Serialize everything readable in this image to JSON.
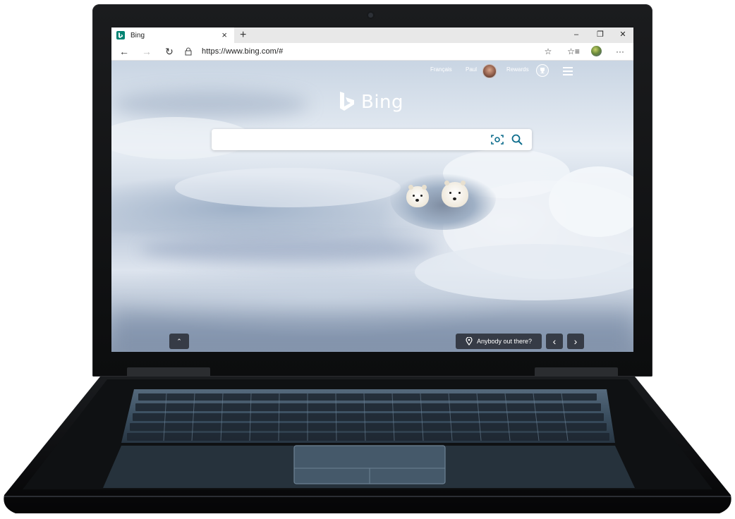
{
  "browser": {
    "tab_title": "Bing",
    "tab_close": "×",
    "new_tab": "+",
    "window_controls": {
      "minimize": "–",
      "restore": "❐",
      "close": "✕"
    },
    "nav": {
      "back": "←",
      "forward": "→",
      "refresh": "↻"
    },
    "url": "https://www.bing.com/#",
    "toolbar": {
      "favorite": "☆",
      "favorites_list": "☆≡",
      "more": "···"
    }
  },
  "bing": {
    "nav": {
      "language": "Français",
      "user": "Paul",
      "rewards": "Rewards"
    },
    "logo_text": "Bing",
    "search": {
      "placeholder": "",
      "value": ""
    },
    "image_info": {
      "label": "Anybody out there?"
    },
    "buttons": {
      "expand": "⌃",
      "prev": "‹",
      "next": "›"
    }
  }
}
